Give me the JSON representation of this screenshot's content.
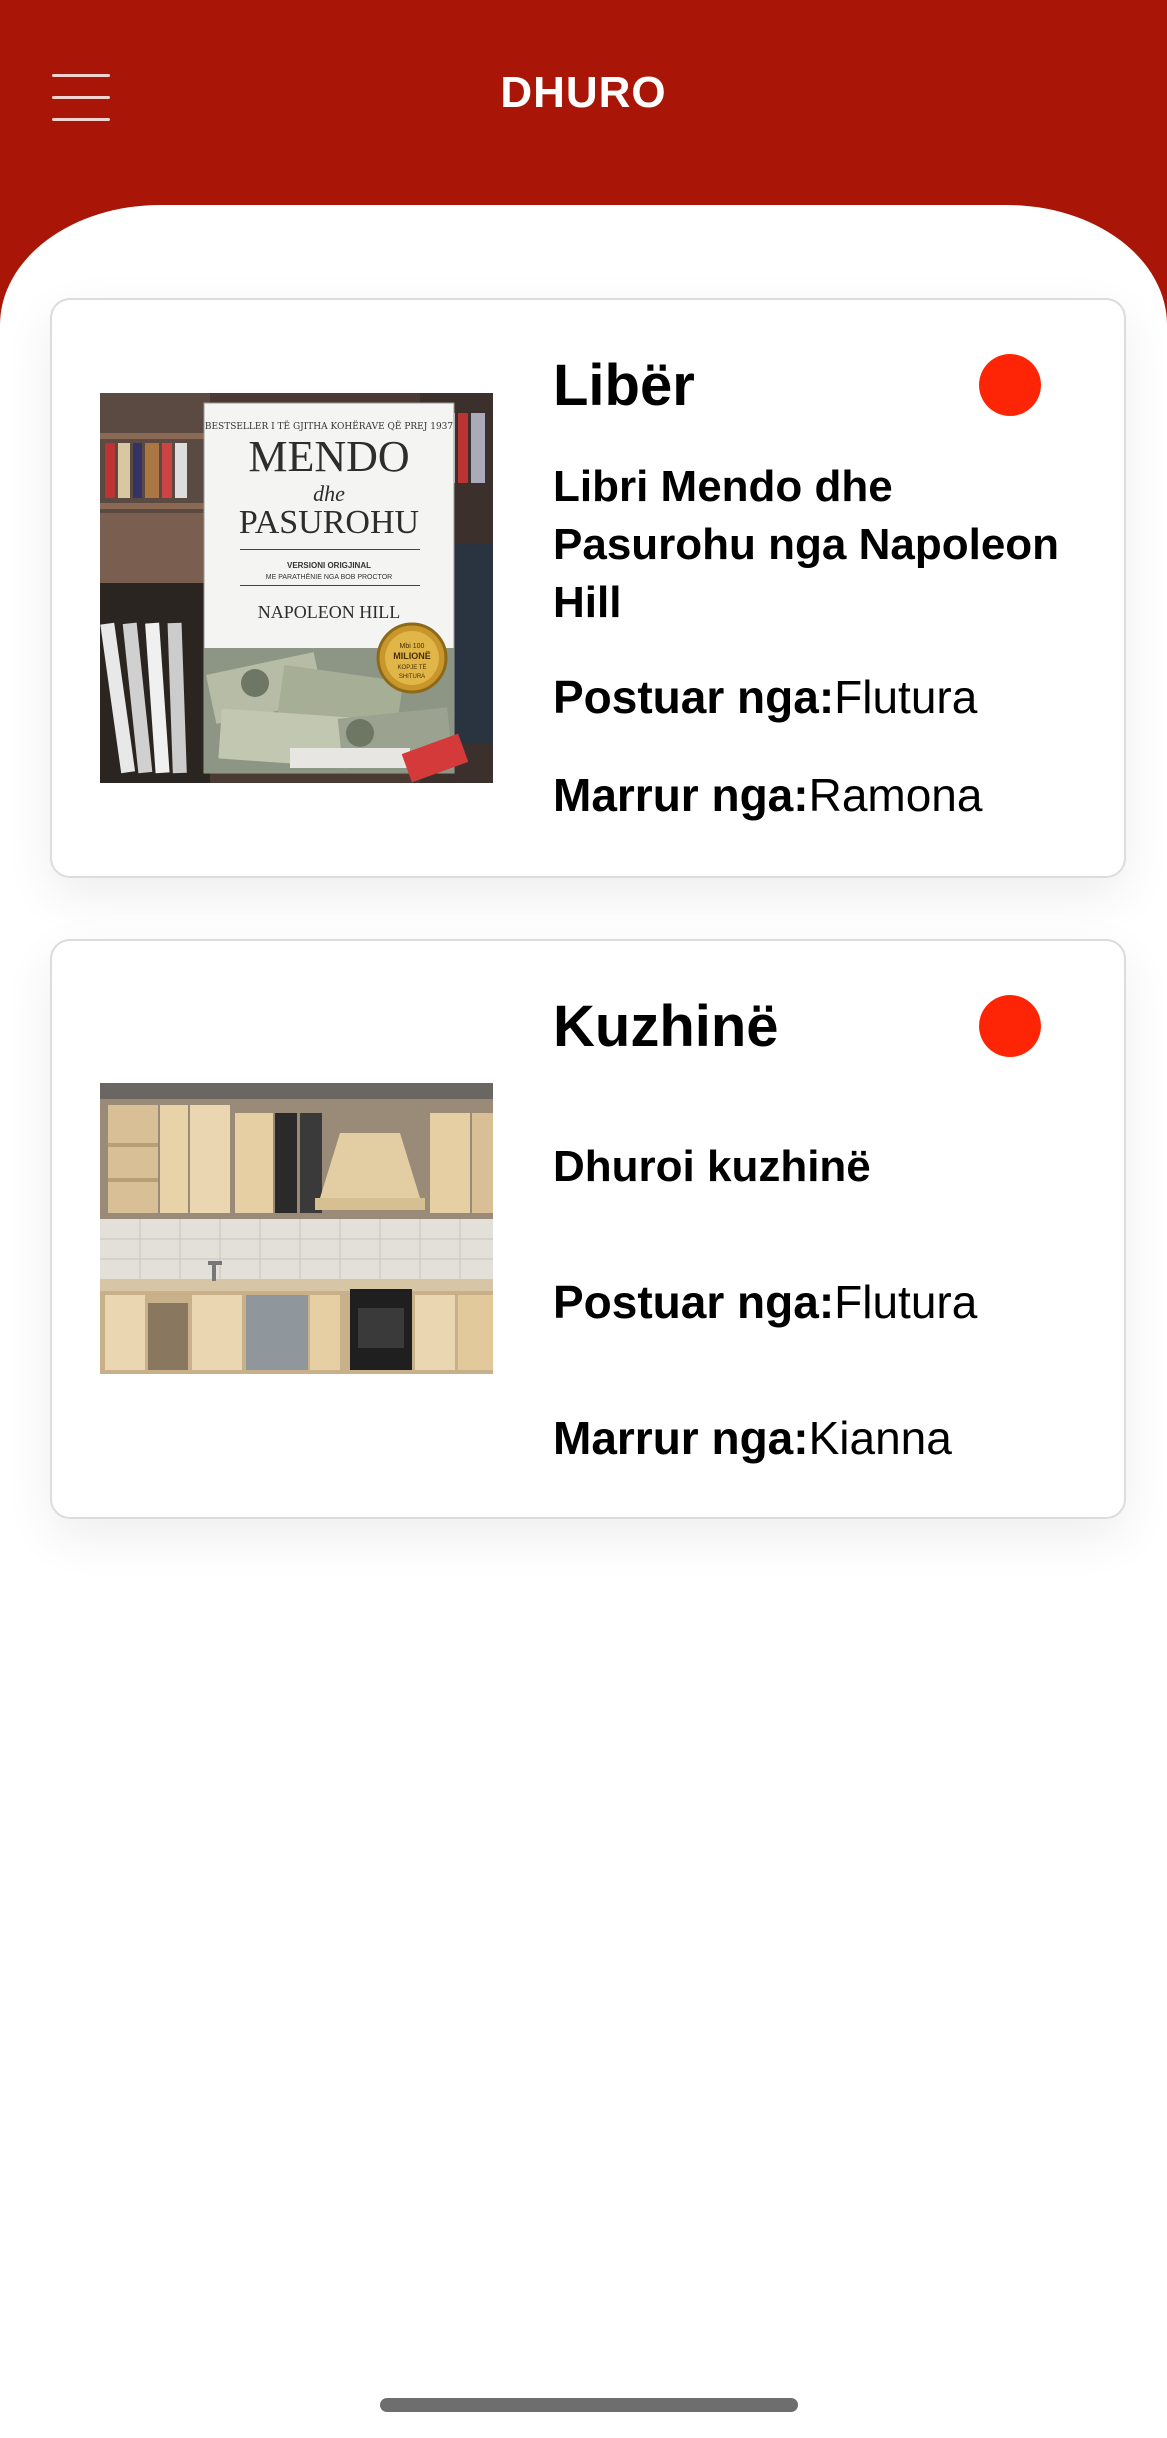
{
  "header": {
    "title": "DHURO",
    "menu_icon": "hamburger-menu-icon",
    "background_color": "#a91608"
  },
  "donations": [
    {
      "category": "Libër",
      "description": "Libri Mendo dhe Pasurohu nga Napoleon Hill",
      "posted_label": "Postuar nga:",
      "posted_by": "Flutura",
      "taken_label": "Marrur nga:",
      "taken_by": "Ramona",
      "status_color": "#fe2506",
      "image": {
        "top_line": "BESTSELLER I TË GJITHA KOHËRAVE QË PREJ 1937",
        "title_1": "MENDO",
        "title_2": "dhe",
        "title_3": "PASUROHU",
        "subtitle_1": "VERSIONI ORIGJINAL",
        "subtitle_2": "ME PARATHËNIE NGA BOB PROCTOR",
        "author": "NAPOLEON HILL",
        "badge_1": "Mbi 100",
        "badge_2": "MILIONË",
        "badge_3": "KOPJE TË",
        "badge_4": "SHITURA"
      }
    },
    {
      "category": "Kuzhinë",
      "description": "Dhuroi kuzhinë",
      "posted_label": "Postuar nga:",
      "posted_by": "Flutura",
      "taken_label": "Marrur nga:",
      "taken_by": "Kianna",
      "status_color": "#fe2506"
    }
  ]
}
